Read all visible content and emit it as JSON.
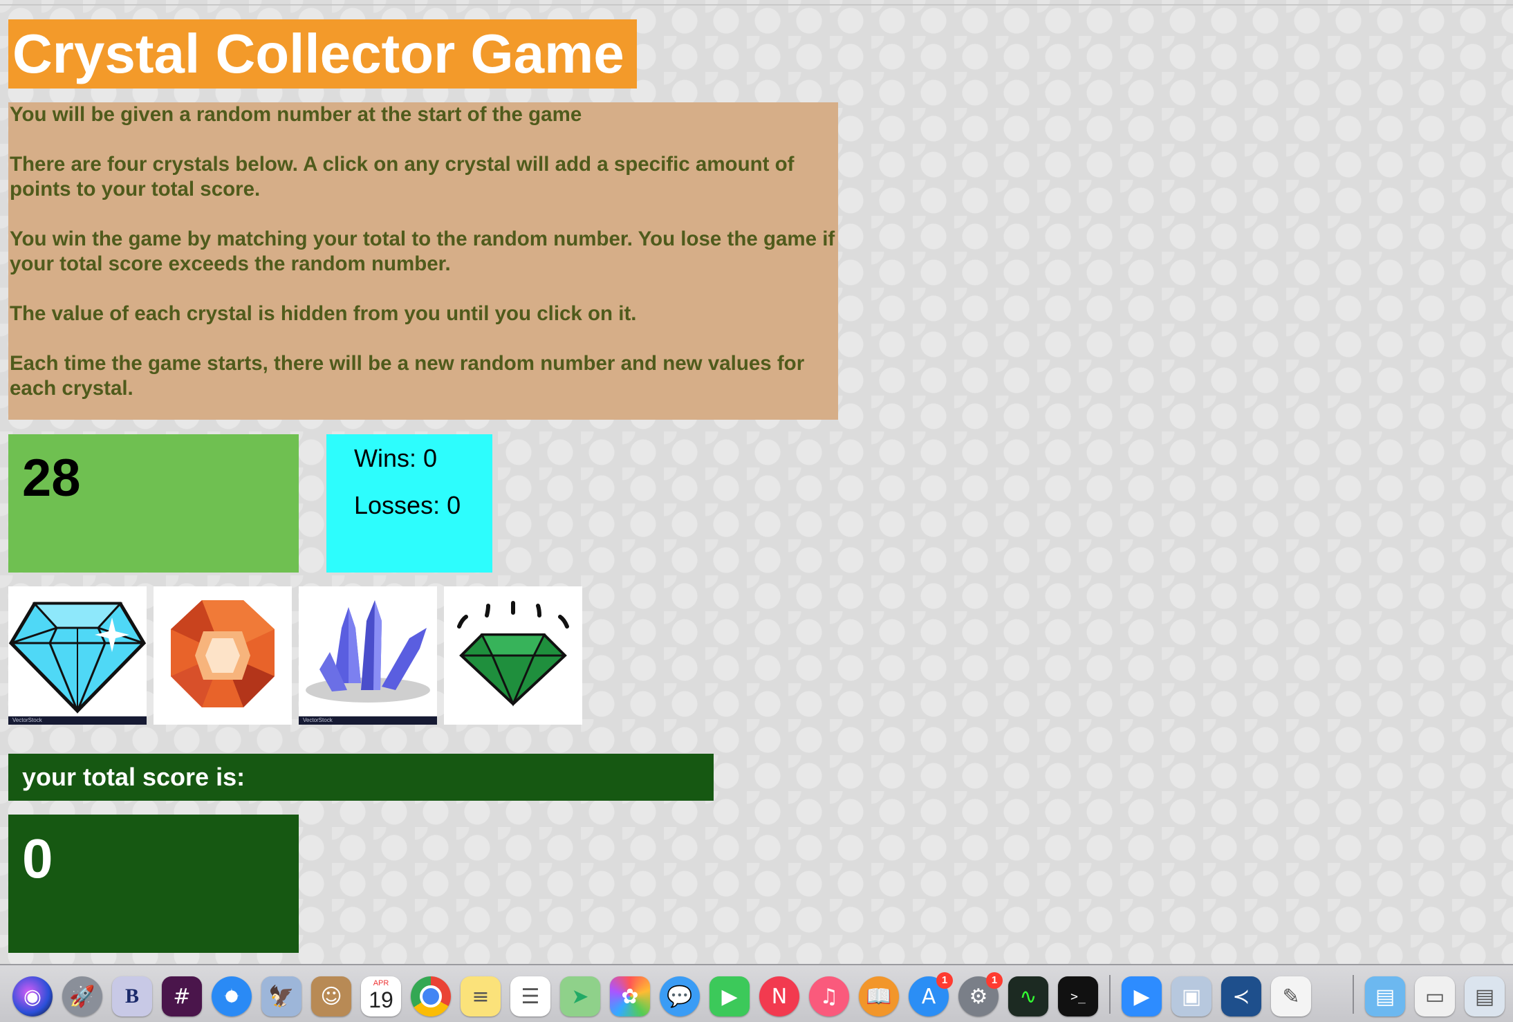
{
  "title": "Crystal Collector Game",
  "instructions": [
    "You will be given a random number at the start of the game",
    "There are four crystals below. A click on any crystal will add a specific amount of points to your total score.",
    "You win the game by matching your total to the random number. You lose the game if your total score exceeds the random number.",
    "The value of each crystal is hidden from you until you click on it.",
    "Each time the game starts, there will be a new random number and new values for each crystal."
  ],
  "target_number": "28",
  "stats": {
    "wins": "Wins: 0",
    "losses": "Losses: 0"
  },
  "crystals": [
    {
      "name": "blue-diamond",
      "color": "#4fd8f6",
      "watermark": "VectorStock"
    },
    {
      "name": "orange-gem",
      "color": "#e8632a"
    },
    {
      "name": "purple-crystal-cluster",
      "color": "#5a5ee0",
      "watermark": "VectorStock"
    },
    {
      "name": "green-emerald",
      "color": "#1f8f3d"
    }
  ],
  "score_header": "your total score is:",
  "total_score": "0",
  "colors": {
    "title_bg": "#f39a2a",
    "instructions_bg": "#d6ae88",
    "instructions_text": "#4f5b1c",
    "target_bg": "#6fc051",
    "stats_bg": "#2dfdfd",
    "score_bg": "#165812"
  },
  "dock": {
    "apps": [
      {
        "name": "siri",
        "badge": ""
      },
      {
        "name": "launchpad",
        "badge": ""
      },
      {
        "name": "bbedit",
        "badge": ""
      },
      {
        "name": "slack",
        "badge": ""
      },
      {
        "name": "safari",
        "badge": ""
      },
      {
        "name": "eagle-app",
        "badge": ""
      },
      {
        "name": "contacts",
        "badge": ""
      },
      {
        "name": "calendar",
        "badge": ""
      },
      {
        "name": "chrome",
        "badge": ""
      },
      {
        "name": "notes",
        "badge": ""
      },
      {
        "name": "reminders",
        "badge": ""
      },
      {
        "name": "maps",
        "badge": ""
      },
      {
        "name": "photos",
        "badge": ""
      },
      {
        "name": "messages",
        "badge": ""
      },
      {
        "name": "facetime",
        "badge": ""
      },
      {
        "name": "news",
        "badge": ""
      },
      {
        "name": "music",
        "badge": ""
      },
      {
        "name": "books",
        "badge": ""
      },
      {
        "name": "app-store",
        "badge": "1"
      },
      {
        "name": "system-preferences",
        "badge": "1"
      },
      {
        "name": "activity-monitor",
        "badge": ""
      },
      {
        "name": "terminal",
        "badge": ""
      },
      {
        "name": "zoom",
        "badge": ""
      },
      {
        "name": "preview",
        "badge": ""
      },
      {
        "name": "vscode",
        "badge": ""
      },
      {
        "name": "textedit",
        "badge": ""
      },
      {
        "name": "downloads-folder",
        "badge": ""
      },
      {
        "name": "screenshot-stack-1",
        "badge": ""
      },
      {
        "name": "screenshot-stack-2",
        "badge": ""
      }
    ],
    "calendar_month": "APR",
    "calendar_day": "19",
    "terminal_prompt": ">_"
  }
}
